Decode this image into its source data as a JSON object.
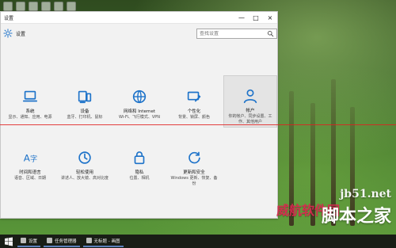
{
  "window": {
    "title": "设置",
    "header_title": "设置",
    "search": {
      "placeholder": "查找设置"
    },
    "controls": {
      "minimize": "—",
      "maximize": "□",
      "close": "×"
    }
  },
  "tiles": [
    {
      "label": "系统",
      "desc": "显示、通知、应用、电源",
      "icon": "laptop-icon"
    },
    {
      "label": "设备",
      "desc": "蓝牙、打印机、鼠标",
      "icon": "devices-icon"
    },
    {
      "label": "网络和 Internet",
      "desc": "Wi-Fi、飞行模式、VPN",
      "icon": "globe-icon"
    },
    {
      "label": "个性化",
      "desc": "背景、锁屏、颜色",
      "icon": "brush-icon"
    },
    {
      "label": "帐户",
      "desc": "你的帐户、同步设置、工作、其他用户",
      "icon": "user-icon",
      "selected": true
    },
    {
      "label": "时间和语言",
      "desc": "语音、区域、日期",
      "icon": "time-language-icon"
    },
    {
      "label": "轻松使用",
      "desc": "讲述人、放大镜、高对比度",
      "icon": "ease-of-access-icon"
    },
    {
      "label": "隐私",
      "desc": "位置、相机",
      "icon": "lock-icon"
    },
    {
      "label": "更新和安全",
      "desc": "Windows 更新、恢复、备份",
      "icon": "update-icon"
    }
  ],
  "watermark": {
    "url": "jb51.net",
    "text_cn": "脚本之家",
    "text_red": "威航软件园"
  },
  "taskbar": {
    "items": [
      {
        "label": "设置"
      },
      {
        "label": "任务管理器"
      },
      {
        "label": "无标题 - 画图"
      }
    ]
  }
}
